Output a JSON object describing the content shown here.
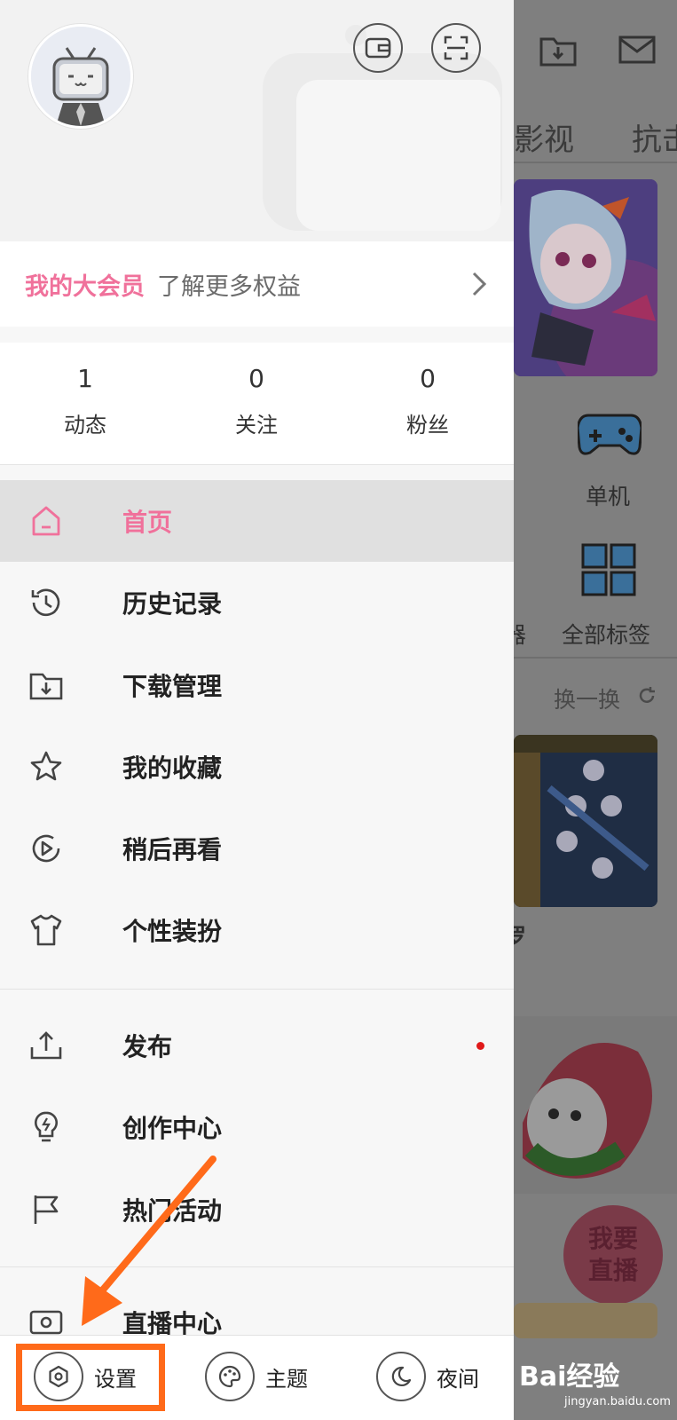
{
  "background_app": {
    "tabs": [
      "影视",
      "抗击"
    ],
    "category_1": "单机",
    "category_2": "全部标签",
    "category_partial": "器",
    "refresh_label": "换一换",
    "card_partial_text": "罗",
    "live_button": "我要直播"
  },
  "drawer": {
    "vip": {
      "title": "我的大会员",
      "subtitle": "了解更多权益"
    },
    "stats": [
      {
        "value": "1",
        "label": "动态"
      },
      {
        "value": "0",
        "label": "关注"
      },
      {
        "value": "0",
        "label": "粉丝"
      }
    ],
    "menu_primary": [
      {
        "label": "首页",
        "icon": "home-icon",
        "active": true
      },
      {
        "label": "历史记录",
        "icon": "history-icon"
      },
      {
        "label": "下载管理",
        "icon": "download-folder-icon"
      },
      {
        "label": "我的收藏",
        "icon": "star-icon"
      },
      {
        "label": "稍后再看",
        "icon": "watch-later-icon"
      },
      {
        "label": "个性装扮",
        "icon": "tshirt-icon"
      }
    ],
    "menu_secondary": [
      {
        "label": "发布",
        "icon": "upload-icon",
        "badge": "red-dot"
      },
      {
        "label": "创作中心",
        "icon": "bulb-icon"
      },
      {
        "label": "热门活动",
        "icon": "flag-icon"
      }
    ],
    "menu_tertiary": [
      {
        "label": "直播中心",
        "icon": "live-tv-icon"
      }
    ],
    "bottom_bar": {
      "settings": "设置",
      "theme": "主题",
      "night": "夜间"
    }
  },
  "watermark": {
    "brand": "Bai经验",
    "domain": "jingyan.baidu.com"
  },
  "colors": {
    "accent_pink": "#f0719b",
    "annotation_orange": "#ff6a1a",
    "badge_red": "#e01a1a"
  }
}
